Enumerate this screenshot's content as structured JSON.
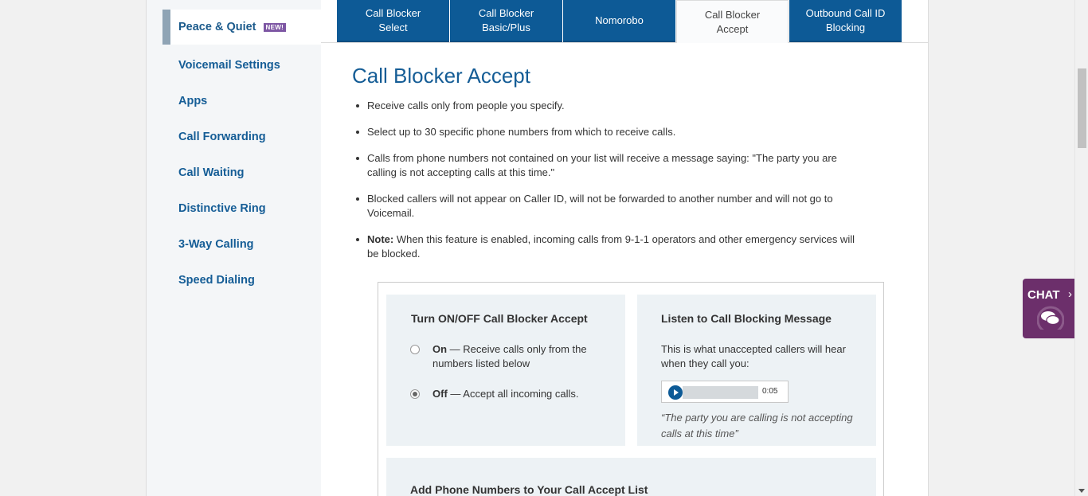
{
  "sidebar": {
    "items": [
      {
        "label": "Peace & Quiet",
        "badge": "NEW!"
      },
      {
        "label": "Voicemail Settings"
      },
      {
        "label": "Apps"
      },
      {
        "label": "Call Forwarding"
      },
      {
        "label": "Call Waiting"
      },
      {
        "label": "Distinctive Ring"
      },
      {
        "label": "3-Way Calling"
      },
      {
        "label": "Speed Dialing"
      }
    ]
  },
  "tabs": [
    {
      "line1": "Call Blocker",
      "line2": "Select"
    },
    {
      "line1": "Call Blocker",
      "line2": "Basic/Plus"
    },
    {
      "line1": "Nomorobo",
      "line2": ""
    },
    {
      "line1": "Call Blocker",
      "line2": "Accept"
    },
    {
      "line1": "Outbound Call ID",
      "line2": "Blocking"
    }
  ],
  "active_tab": "Call Blocker Accept",
  "content": {
    "title": "Call Blocker Accept",
    "bullets": [
      {
        "bold": "",
        "text": "Receive calls only from people you specify."
      },
      {
        "bold": "",
        "text": "Select up to 30 specific phone numbers from which to receive calls."
      },
      {
        "bold": "",
        "text": "Calls from phone numbers not contained on your list will receive a message saying: \"The party you are calling is not accepting calls at this time.\""
      },
      {
        "bold": "",
        "text": "Blocked callers will not appear on Caller ID, will not be forwarded to another number and will not go to Voicemail."
      },
      {
        "bold": "Note:",
        "text": " When this feature is enabled, incoming calls from 9-1-1 operators and other emergency services will be blocked."
      }
    ]
  },
  "toggle_card": {
    "heading": "Turn ON/OFF Call Blocker Accept",
    "on_label": "On",
    "on_text": " — Receive calls only from the numbers listed below",
    "off_label": "Off",
    "off_text": " — Accept all incoming calls.",
    "selected": "Off"
  },
  "listen_card": {
    "heading": "Listen to Call Blocking Message",
    "description": "This is what unaccepted callers will hear when they call you:",
    "duration": "0:05",
    "quote": "“The party you are calling is not accepting calls at this time”"
  },
  "add_card": {
    "heading": "Add Phone Numbers to Your Call Accept List"
  },
  "chat": {
    "label": "CHAT",
    "arrow": "›"
  },
  "colors": {
    "brand_blue": "#0d5a96",
    "link_blue": "#155d96",
    "chat_purple": "#6c2f6b",
    "badge_purple": "#7d56a3"
  }
}
